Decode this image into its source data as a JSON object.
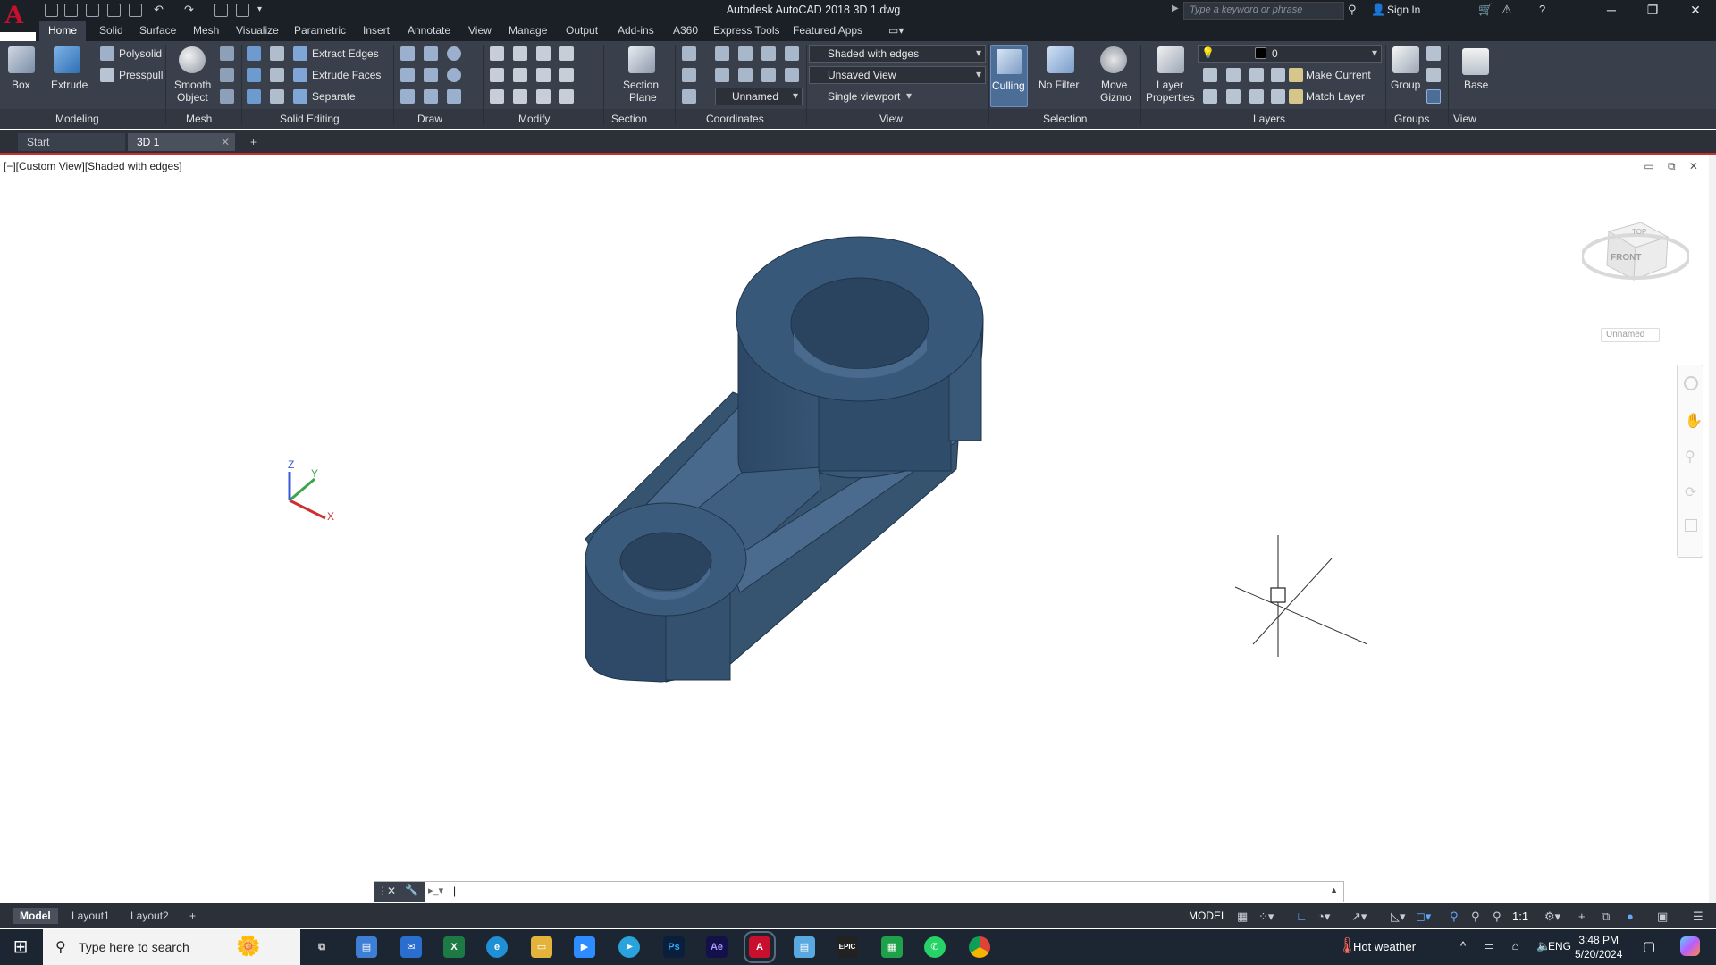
{
  "window": {
    "title": "Autodesk AutoCAD 2018    3D 1.dwg",
    "search_placeholder": "Type a keyword or phrase",
    "sign_in": "Sign In",
    "minimize": "─",
    "maximize": "❐",
    "close": "✕"
  },
  "ribbon_tabs": [
    "Home",
    "Solid",
    "Surface",
    "Mesh",
    "Visualize",
    "Parametric",
    "Insert",
    "Annotate",
    "View",
    "Manage",
    "Output",
    "Add-ins",
    "A360",
    "Express Tools",
    "Featured Apps"
  ],
  "ribbon": {
    "modeling": {
      "box": "Box",
      "extrude": "Extrude",
      "polysolid": "Polysolid",
      "presspull": "Presspull",
      "title": "Modeling"
    },
    "mesh": {
      "smooth_object_1": "Smooth",
      "smooth_object_2": "Object",
      "title": "Mesh"
    },
    "solid_editing": {
      "extract_edges": "Extract Edges",
      "extrude_faces": "Extrude Faces",
      "separate": "Separate",
      "title": "Solid Editing"
    },
    "draw": {
      "title": "Draw"
    },
    "modify": {
      "title": "Modify"
    },
    "section": {
      "section_plane_1": "Section",
      "section_plane_2": "Plane",
      "title": "Section"
    },
    "coordinates": {
      "ucs_name": "Unnamed",
      "title": "Coordinates"
    },
    "view": {
      "visual_style": "Shaded with edges",
      "named_view": "Unsaved View",
      "viewport": "Single viewport",
      "title": "View"
    },
    "selection": {
      "culling": "Culling",
      "no_filter": "No Filter",
      "move_gizmo_1": "Move",
      "move_gizmo_2": "Gizmo",
      "title": "Selection"
    },
    "layers": {
      "layer_props_1": "Layer",
      "layer_props_2": "Properties",
      "current_layer": "0",
      "make_current": "Make Current",
      "match_layer": "Match Layer",
      "title": "Layers"
    },
    "groups": {
      "group": "Group",
      "title": "Groups"
    },
    "view2": {
      "base": "Base",
      "title": "View"
    }
  },
  "doc_tabs": [
    "Start",
    "3D 1"
  ],
  "viewport": {
    "label": "[−][Custom View][Shaded with edges]",
    "viewcube_top": "TOP",
    "viewcube_front": "FRONT",
    "ucs_name": "Unnamed",
    "axis_x": "X",
    "axis_y": "Y",
    "axis_z": "Z"
  },
  "layout_tabs": [
    "Model",
    "Layout1",
    "Layout2"
  ],
  "status": {
    "model": "MODEL",
    "scale": "1:1"
  },
  "taskbar": {
    "search_placeholder": "Type here to search",
    "weather": "Hot weather",
    "lang": "ENG",
    "time": "3:48 PM",
    "date": "5/20/2024"
  },
  "colors": {
    "accent": "#c8302c",
    "ribbon_bg": "#3a404b",
    "model_blue": "#3a5877"
  }
}
